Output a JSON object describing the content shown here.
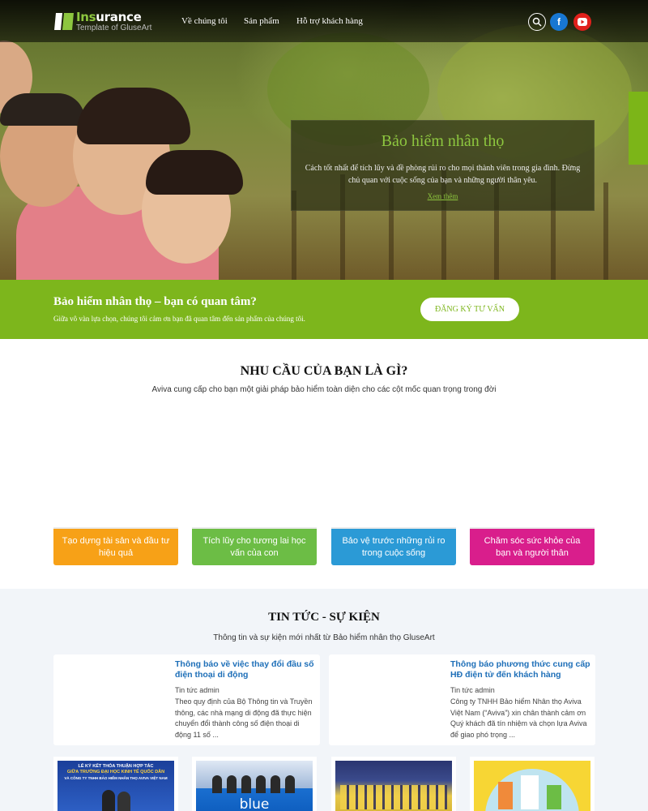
{
  "brand": {
    "title_a": "Ins",
    "title_b": "urance",
    "subtitle": "Template of GluseArt",
    "accent": "#8dc63f"
  },
  "nav": {
    "items": [
      "Về chúng tôi",
      "Sản phẩm",
      "Hỗ trợ khách hàng"
    ],
    "icons": [
      "search-icon",
      "facebook-icon",
      "youtube-icon"
    ]
  },
  "hero": {
    "title": "Bảo hiểm nhân thọ",
    "text": "Cách tốt nhất để tích lũy và đề phòng rủi ro cho mọi thành viên trong gia đình. Đừng chủ quan với cuộc sống của bạn và những người thân yêu.",
    "link": "Xem thêm"
  },
  "band": {
    "title": "Bảo hiểm nhân thọ – bạn có quan tâm?",
    "text": "Giữa vô vàn lựa chọn, chúng tôi cảm ơn bạn đã quan tâm đến sản phẩm của chúng tôi.",
    "button": "ĐĂNG KÝ TƯ VẤN",
    "color": "#7db61c"
  },
  "needs": {
    "title": "NHU CẦU CỦA BẠN LÀ GÌ?",
    "subtitle": "Aviva cung cấp cho bạn một giải pháp bảo hiểm toàn diện cho các cột mốc quan trọng trong đời",
    "cards": [
      {
        "label": "Tạo dựng tài sản và đầu tư hiệu quả",
        "color": "#f7a117"
      },
      {
        "label": "Tích lũy cho tương lai học vấn của con",
        "color": "#6cbd45"
      },
      {
        "label": "Bảo vệ trước những rủi ro trong cuộc sống",
        "color": "#2b9ad6"
      },
      {
        "label": "Chăm sóc sức khỏe của bạn và người thân",
        "color": "#d91e8c"
      }
    ]
  },
  "news": {
    "title": "TIN TỨC - SỰ KIỆN",
    "subtitle": "Thông tin và sự kiện mới nhất từ Bảo hiểm nhân thọ GluseArt",
    "items": [
      {
        "title": "Thông báo về việc thay đổi đầu số điện thoại di động",
        "meta": "Tin tức admin",
        "excerpt": "Theo quy định của Bộ Thông tin và Truyền thông, các nhà mạng di động đã thực hiện chuyển đổi thành công số điện thoại di động 11 số ..."
      },
      {
        "title": "Thông báo phương thức cung cấp HĐ điện tử đến khách hàng",
        "meta": "Tin tức admin",
        "excerpt": "Công ty TNHH Bảo hiểm Nhân thọ Aviva Việt Nam (“Aviva”) xin chân thành cảm ơn Quý khách đã tín nhiệm và chọn lựa Aviva để giao phó trọng ..."
      }
    ],
    "photos": [
      {
        "caption": "LỄ KÝ KẾT THỎA THUẬN HỢP TÁC",
        "caption2": "GIỮA TRƯỜNG ĐẠI HỌC KINH TẾ QUỐC DÂN",
        "caption3": "VÀ CÔNG TY TNHH BẢO HIỂM NHÂN THỌ AVIVA VIỆT NAM"
      },
      {
        "caption": "blue"
      },
      {
        "caption": ""
      },
      {
        "caption": ""
      }
    ]
  }
}
